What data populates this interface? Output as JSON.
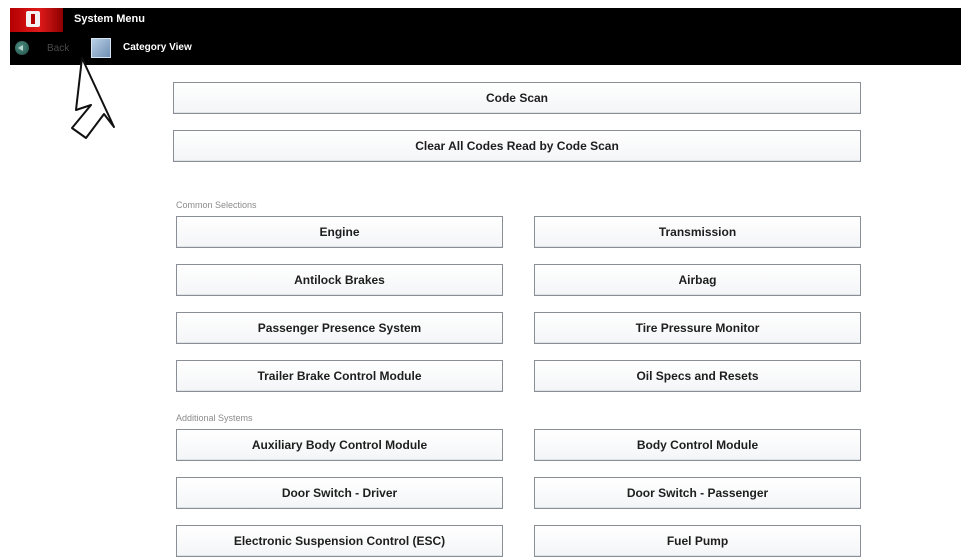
{
  "header": {
    "title": "System Menu",
    "back_label": "Back",
    "view_label": "Category View"
  },
  "top_actions": [
    {
      "label": "Code Scan"
    },
    {
      "label": "Clear All Codes Read by Code Scan"
    }
  ],
  "common_selections": {
    "label": "Common Selections",
    "items": [
      "Engine",
      "Transmission",
      "Antilock Brakes",
      "Airbag",
      "Passenger Presence System",
      "Tire Pressure Monitor",
      "Trailer Brake Control Module",
      "Oil Specs and Resets"
    ]
  },
  "additional_systems": {
    "label": "Additional Systems",
    "items": [
      "Auxiliary Body Control Module",
      "Body Control Module",
      "Door Switch - Driver",
      "Door Switch - Passenger",
      "Electronic Suspension Control (ESC)",
      "Fuel Pump"
    ]
  },
  "icons": {
    "logo": "app-logo",
    "back": "back-arrow-icon",
    "view": "category-view-icon",
    "pointer": "pointer-arrow-icon"
  }
}
